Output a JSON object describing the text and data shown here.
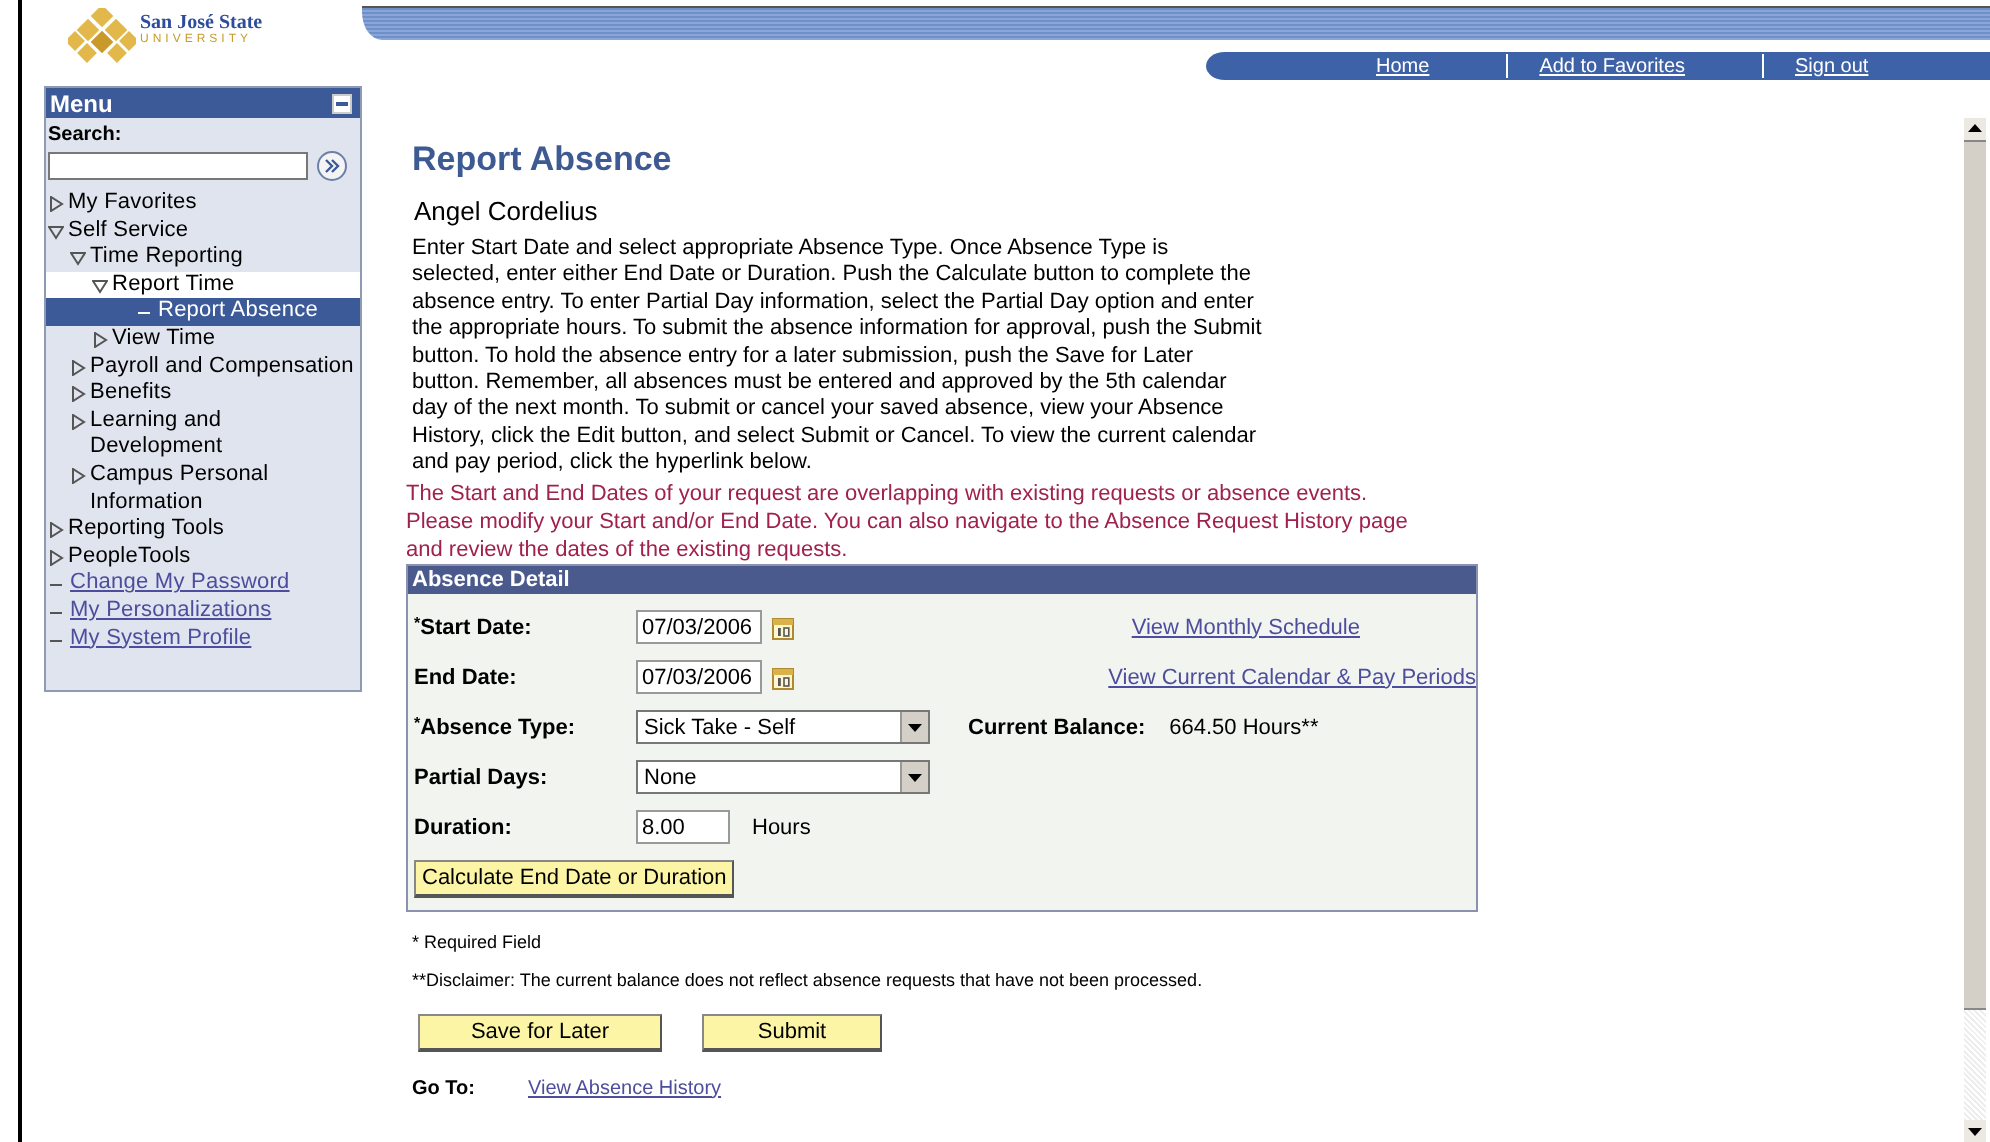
{
  "logo": {
    "name": "San José State",
    "subtitle": "UNIVERSITY"
  },
  "nav_links": [
    "Home",
    "Add to Favorites",
    "Sign out"
  ],
  "menu": {
    "title": "Menu",
    "search_label": "Search:",
    "items": [
      {
        "label": "My Favorites",
        "kind": "folder",
        "expanded": false,
        "selected": false,
        "highlighted": false
      },
      {
        "label": "Self Service",
        "kind": "folder",
        "expanded": true,
        "selected": false,
        "highlighted": false,
        "children": [
          {
            "label": "Time Reporting",
            "kind": "folder",
            "expanded": true,
            "selected": false,
            "highlighted": false,
            "children": [
              {
                "label": "Report Time",
                "kind": "folder",
                "expanded": true,
                "selected": false,
                "highlighted": true,
                "children": [
                  {
                    "label": "Report Absence",
                    "kind": "leaf",
                    "selected": true
                  }
                ]
              },
              {
                "label": "View Time",
                "kind": "folder",
                "expanded": false,
                "selected": false,
                "highlighted": false
              }
            ]
          },
          {
            "label": "Payroll and Compensation",
            "kind": "folder",
            "expanded": false,
            "selected": false,
            "highlighted": false
          },
          {
            "label": "Benefits",
            "kind": "folder",
            "expanded": false,
            "selected": false,
            "highlighted": false
          },
          {
            "label": "Learning and Development",
            "kind": "folder",
            "expanded": false,
            "selected": false,
            "highlighted": false
          },
          {
            "label": "Campus Personal Information",
            "kind": "folder",
            "expanded": false,
            "selected": false,
            "highlighted": false
          }
        ]
      },
      {
        "label": "Reporting Tools",
        "kind": "folder",
        "expanded": false,
        "selected": false,
        "highlighted": false
      },
      {
        "label": "PeopleTools",
        "kind": "folder",
        "expanded": false,
        "selected": false,
        "highlighted": false
      },
      {
        "label": "Change My Password",
        "kind": "link",
        "selected": false
      },
      {
        "label": "My Personalizations",
        "kind": "link",
        "selected": false
      },
      {
        "label": "My System Profile",
        "kind": "link",
        "selected": false
      }
    ]
  },
  "page": {
    "title": "Report Absence",
    "employee": "Angel Cordelius",
    "instructions": "Enter Start Date and select appropriate Absence Type. Once Absence Type is selected, enter either End Date or Duration. Push the Calculate button to complete the absence entry. To enter Partial Day information, select the Partial Day option and enter the appropriate hours. To submit the absence information for approval, push the Submit button. To hold the absence entry for a later submission, push the Save for Later button. Remember, all absences must be entered and approved by the 5th calendar day of the next month. To submit or cancel your saved absence, view your Absence History, click the Edit button, and select Submit or Cancel. To view the current calendar and pay period, click the hyperlink below.",
    "error": "The Start and End Dates of your request are overlapping with existing requests or absence events. Please modify your Start and/or End Date. You can also navigate to the Absence Request History page and review the dates of the existing requests."
  },
  "absence_detail": {
    "title": "Absence Detail",
    "start_date": {
      "label": "Start Date:",
      "required_mark": "*",
      "value": "07/03/2006"
    },
    "end_date": {
      "label": "End Date:",
      "value": "07/03/2006"
    },
    "absence_type": {
      "label": "Absence Type:",
      "required_mark": "*",
      "value": "Sick Take - Self"
    },
    "partial_days": {
      "label": "Partial Days:",
      "value": "None"
    },
    "duration": {
      "label": "Duration:",
      "value": "8.00",
      "unit": "Hours"
    },
    "links": [
      "View Monthly Schedule",
      "View Current Calendar & Pay Periods"
    ],
    "balance_label": "Current Balance:",
    "balance_value": "664.50 Hours**",
    "calculate_button": "Calculate End Date or Duration"
  },
  "required_note": "* Required Field",
  "disclaimer": "**Disclaimer: The current balance does not reflect absence requests that have not been processed.",
  "buttons": [
    "Save for Later",
    "Submit"
  ],
  "go_to": {
    "label": "Go To:",
    "link": "View Absence History"
  }
}
